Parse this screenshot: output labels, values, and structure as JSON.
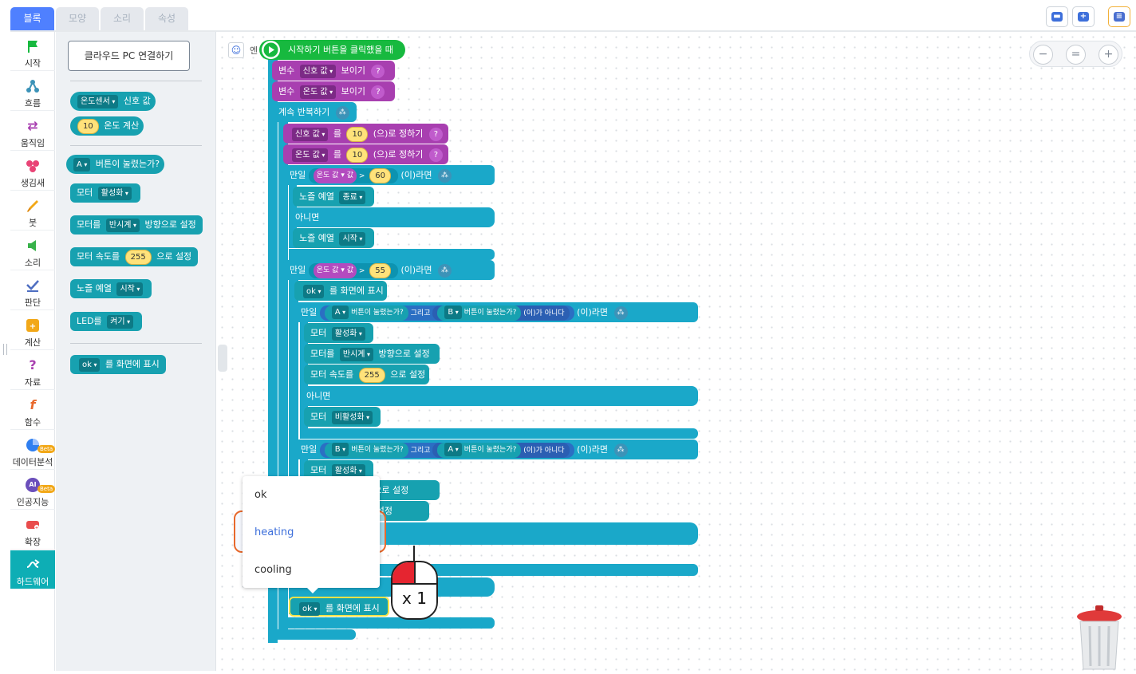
{
  "tabs": [
    {
      "label": "블록",
      "active": true
    },
    {
      "label": "모양"
    },
    {
      "label": "소리"
    },
    {
      "label": "속성"
    }
  ],
  "toolbar_icons": [
    "chat-icon",
    "add-object-icon",
    "save-icon"
  ],
  "categories": [
    {
      "label": "시작",
      "icon": "flag-icon",
      "color": "#17b93f"
    },
    {
      "label": "흐름",
      "icon": "flow-icon",
      "color": "#3c93b8"
    },
    {
      "label": "움직임",
      "icon": "move-arrows-icon",
      "color": "#a83fb0"
    },
    {
      "label": "생김새",
      "icon": "looks-icon",
      "color": "#e94376"
    },
    {
      "label": "붓",
      "icon": "brush-icon",
      "color": "#f2a818"
    },
    {
      "label": "소리",
      "icon": "speaker-icon",
      "color": "#38b24a"
    },
    {
      "label": "판단",
      "icon": "check-icon",
      "color": "#4e6ec1"
    },
    {
      "label": "계산",
      "icon": "calculator-icon",
      "color": "#f2a818"
    },
    {
      "label": "자료",
      "icon": "question-icon",
      "color": "#a83fb0"
    },
    {
      "label": "함수",
      "icon": "function-icon",
      "color": "#e8692c"
    },
    {
      "label": "데이터분석",
      "icon": "pie-chart-icon",
      "color": "#2f7ff0",
      "badge": "Beta"
    },
    {
      "label": "인공지능",
      "icon": "ai-icon",
      "color": "#6b4fbb",
      "badge": "Beta",
      "prefix": "AI"
    },
    {
      "label": "확장",
      "icon": "extension-icon",
      "color": "#e94c4c"
    },
    {
      "label": "하드웨어",
      "icon": "hardware-icon",
      "color": "#ffffff",
      "active": true
    }
  ],
  "palette": {
    "cloud_button": "클라우드 PC 연결하기",
    "sensor_block": {
      "dropdown": "온도센서",
      "text": "신호 값"
    },
    "temp_calc": {
      "num": "10",
      "text": "온도 계산"
    },
    "button_pressed": {
      "dropdown": "A",
      "text": "버튼이 눌렸는가?"
    },
    "motor_activate": {
      "text": "모터",
      "dropdown": "활성화"
    },
    "motor_direction": {
      "text": "모터를",
      "dropdown": "반시계",
      "suffix": "방향으로 설정"
    },
    "motor_speed": {
      "text": "모터 속도를",
      "num": "255",
      "suffix": "으로 설정"
    },
    "play_song": {
      "text": "노즐 예열",
      "dropdown": "시작"
    },
    "led": {
      "text": "LED를",
      "dropdown": "켜기"
    },
    "show_screen": {
      "dropdown": "ok",
      "text": "를 화면에 표시"
    }
  },
  "workspace": {
    "object_label": "엔",
    "start_block": "시작하기 버튼을 클릭했을 때",
    "var1": {
      "text": "변수",
      "dropdown": "신호 값",
      "suffix": "보이기"
    },
    "var2": {
      "text": "변수",
      "dropdown": "온도 값",
      "suffix": "보이기"
    },
    "loop": "계속 반복하기",
    "set1": {
      "dropdown": "신호 값",
      "text": "를",
      "num": "10",
      "suffix": "(으)로 정하기"
    },
    "set2": {
      "dropdown": "온도 값",
      "text": "를",
      "num": "10",
      "suffix": "(으)로 정하기"
    },
    "if1": {
      "text": "만일",
      "var": "온도 값",
      "val": "값",
      "op": ">",
      "num": "60",
      "suffix": "(이)라면"
    },
    "nozzle_end": {
      "text": "노즐 예열",
      "dropdown": "종료"
    },
    "else1": "아니면",
    "nozzle_start": {
      "text": "노즐 예열",
      "dropdown": "시작"
    },
    "if2": {
      "text": "만일",
      "var": "온도 값",
      "val": "값",
      "op": ">",
      "num": "55",
      "suffix": "(이)라면"
    },
    "show_ok": {
      "dropdown": "ok",
      "text": "를 화면에 표시"
    },
    "if3": {
      "text": "만일",
      "a": "A",
      "b": "B",
      "cond_text": "버튼이 눌렸는가?",
      "and": "그리고",
      "not": "(이)가 아니다",
      "suffix": "(이)라면"
    },
    "motor_on": {
      "text": "모터",
      "dropdown": "활성화"
    },
    "motor_dir": {
      "text": "모터를",
      "dropdown": "반시계",
      "suffix": "방향으로 설정"
    },
    "motor_spd": {
      "text": "모터 속도를",
      "num": "255",
      "suffix": "으로 설정"
    },
    "else2": "아니면",
    "motor_off": {
      "text": "모터",
      "dropdown": "비활성화"
    },
    "if4": {
      "text": "만일",
      "a": "B",
      "b": "A",
      "cond_text": "버튼이 눌렸는가?",
      "and": "그리고",
      "not": "(이)가 아니다",
      "suffix": "(이)라면"
    },
    "motor_on2": {
      "text": "모터",
      "dropdown": "활성화"
    },
    "frag_dir": "방향으로 설정",
    "frag_spd": "으로 설정",
    "bottom_show": {
      "dropdown": "ok",
      "text": "를 화면에 표시"
    },
    "zoom": {
      "out": "−",
      "reset": "=",
      "in": "+"
    }
  },
  "dropdown_menu": {
    "options": [
      "ok",
      "heating",
      "cooling"
    ],
    "highlighted": "heating"
  },
  "mouse_overlay": {
    "label": "x 1"
  }
}
